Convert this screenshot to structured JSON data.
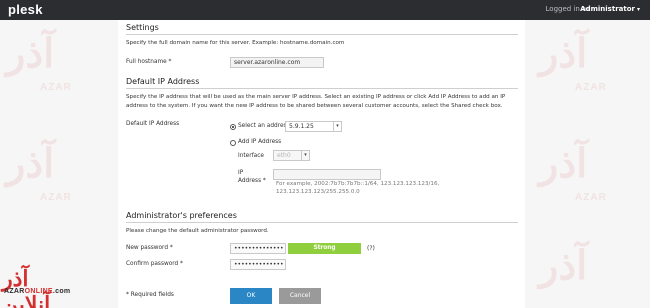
{
  "topbar": {
    "logo": "plesk",
    "logged_in_prefix": "Logged in as",
    "user": "Administrator"
  },
  "watermark": {
    "glyph": "آذر",
    "sub": "AZAR",
    "brand_mark": "آذر آنلاین",
    "brand_text_a": "AZAR",
    "brand_text_b": "ONLINE",
    "brand_text_c": ".com"
  },
  "settings": {
    "title": "Settings",
    "description": "Specify the full domain name for this server. Example: hostname.domain.com",
    "hostname_label": "Full hostname *",
    "hostname_value": "server.azaronline.com"
  },
  "ip": {
    "title": "Default IP Address",
    "description_line1": "Specify the IP address that will be used as the main server IP address. Select an existing IP address or click Add IP Address to add an IP",
    "description_line2": "address to the system. If you want the new IP address to be shared between several customer accounts, select the Shared check box.",
    "label": "Default IP Address",
    "select_option_label": "Select an address",
    "selected_ip": "5.9.1.25",
    "add_option_label": "Add IP Address",
    "interface_label": "Interface",
    "interface_value": "eth0",
    "ip_label_line1": "IP",
    "ip_label_line2": "Address *",
    "ip_example_line1": "For example, 2002:7b7b:7b7b::1/64, 123.123.123.123/16,",
    "ip_example_line2": "123.123.123.123/255.255.0.0"
  },
  "admin": {
    "title": "Administrator's preferences",
    "description": "Please change the default administrator password.",
    "new_password_label": "New password *",
    "new_password_value": "••••••••••••••",
    "strength_label": "Strong",
    "strength_level": 1.0,
    "help": "(?)",
    "confirm_password_label": "Confirm password *",
    "confirm_password_value": "••••••••••••••"
  },
  "footer": {
    "required_note": "* Required fields",
    "ok_label": "OK",
    "cancel_label": "Cancel"
  },
  "colors": {
    "topbar": "#2b2d31",
    "primary_button": "#2a86c4",
    "secondary_button": "#9a9a9a",
    "strength_strong": "#8fcf3e",
    "watermark": "#f1e3e3"
  }
}
